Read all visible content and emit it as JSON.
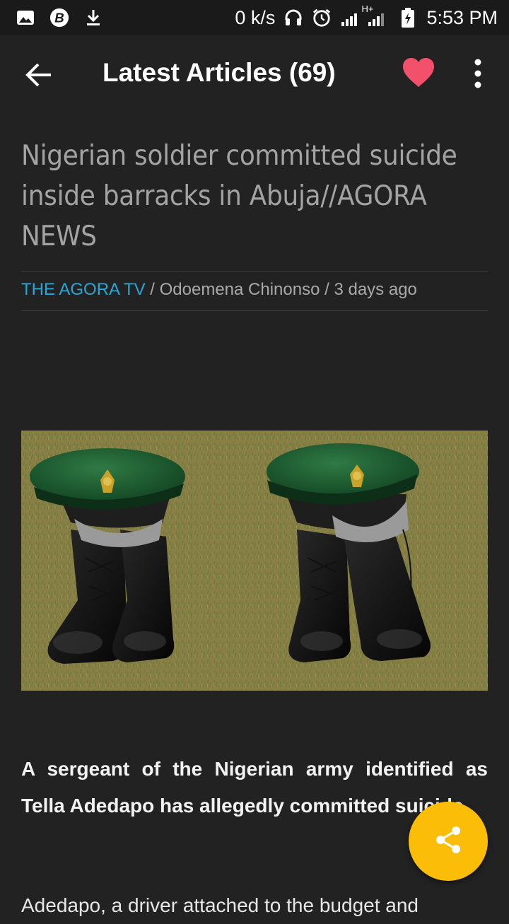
{
  "status_bar": {
    "net_speed": "0 k/s",
    "network_label": "H+",
    "time": "5:53 PM"
  },
  "app_bar": {
    "title": "Latest Articles (69)",
    "heart_color": "#f2506b"
  },
  "article": {
    "headline_lines": [
      "Nigerian soldier committed suicide",
      "inside barracks in Abuja//AGORA",
      "NEWS"
    ],
    "source": "THE AGORA TV",
    "separator_1": " / ",
    "author": "Odoemena Chinonso",
    "separator_2": " / ",
    "published": "3 days ago",
    "image_icon": "berets-and-boots-photo",
    "lead": "A sergeant of the Nigerian army identified as Tella Adedapo has allegedly committed suicide.",
    "body_start": "Adedapo, a driver attached to the budget and"
  },
  "fab": {
    "icon": "share-icon",
    "color": "#fbbd08"
  }
}
